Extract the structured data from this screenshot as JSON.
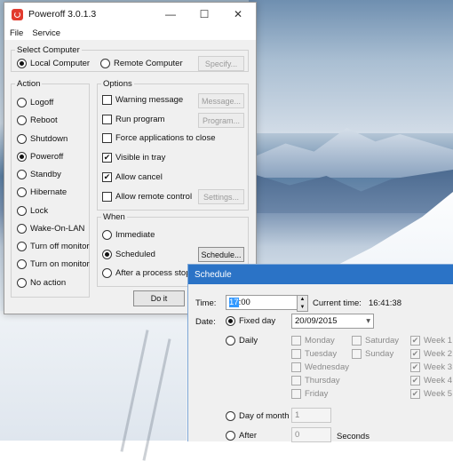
{
  "window": {
    "title": "Poweroff 3.0.1.3",
    "minimize": "—",
    "maximize": "☐",
    "close": "✕"
  },
  "menu": [
    "File",
    "Service"
  ],
  "select_computer": {
    "legend": "Select Computer",
    "local": "Local Computer",
    "remote": "Remote Computer",
    "specify": "Specify..."
  },
  "action": {
    "legend": "Action",
    "items": [
      "Logoff",
      "Reboot",
      "Shutdown",
      "Poweroff",
      "Standby",
      "Hibernate",
      "Lock",
      "Wake-On-LAN",
      "Turn off monitor",
      "Turn on monitor",
      "No action"
    ],
    "selected": "Poweroff"
  },
  "options": {
    "legend": "Options",
    "warning": "Warning message",
    "warning_btn": "Message...",
    "run": "Run program",
    "run_btn": "Program...",
    "force": "Force applications to close",
    "visible": "Visible in tray",
    "allow_cancel": "Allow cancel",
    "remote": "Allow remote control",
    "settings_btn": "Settings..."
  },
  "when": {
    "legend": "When",
    "immediate": "Immediate",
    "scheduled": "Scheduled",
    "schedule_btn": "Schedule...",
    "after_process": "After a process stops"
  },
  "do_it": "Do it",
  "schedule": {
    "title": "Schedule",
    "time_label": "Time:",
    "time_hour": "17",
    "time_rest": ":00",
    "current_time_label": "Current time:",
    "current_time": "16:41:38",
    "date_label": "Date:",
    "fixed_day": "Fixed day",
    "date_value": "20/09/2015",
    "daily": "Daily",
    "days_col1": [
      "Monday",
      "Tuesday",
      "Wednesday",
      "Thursday",
      "Friday"
    ],
    "days_col2": [
      "Saturday",
      "Sunday"
    ],
    "weeks": [
      "Week 1",
      "Week 2",
      "Week 3",
      "Week 4",
      "Week 5"
    ],
    "day_of_month": "Day of month",
    "day_of_month_value": "1",
    "after": "After",
    "after_value": "0",
    "seconds": "Seconds"
  },
  "colors": {
    "accent": "#2b73c6",
    "app_icon": "#e23b2e"
  }
}
